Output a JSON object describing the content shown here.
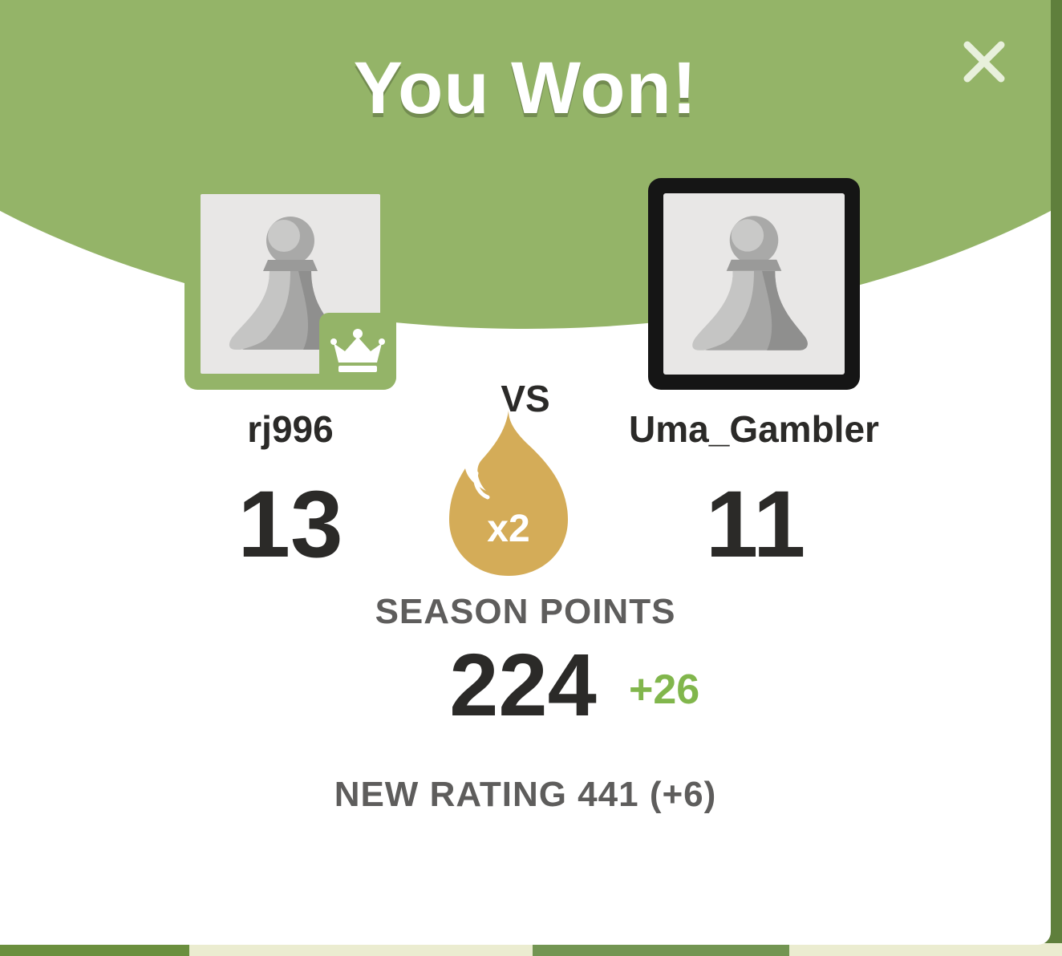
{
  "modal": {
    "title": "You Won!",
    "close_icon": "close-icon"
  },
  "players": {
    "me": {
      "username": "rj996",
      "score": "13",
      "avatar_icon": "pawn-icon",
      "badge_icon": "crown-icon"
    },
    "opponent": {
      "username": "Uma_Gambler",
      "score": "11",
      "avatar_icon": "pawn-icon"
    }
  },
  "versus": {
    "label": "VS",
    "multiplier_icon": "flame-icon",
    "multiplier": "x2"
  },
  "season": {
    "label": "SEASON POINTS",
    "value": "224",
    "delta": "+26"
  },
  "rating": {
    "text": "NEW RATING 441 (+6)"
  },
  "colors": {
    "header_green": "#94b468",
    "delta_green": "#81b64c",
    "flame_gold": "#d4ac58",
    "text_dark": "#2b2a28",
    "text_gray": "#5e5d5c"
  }
}
